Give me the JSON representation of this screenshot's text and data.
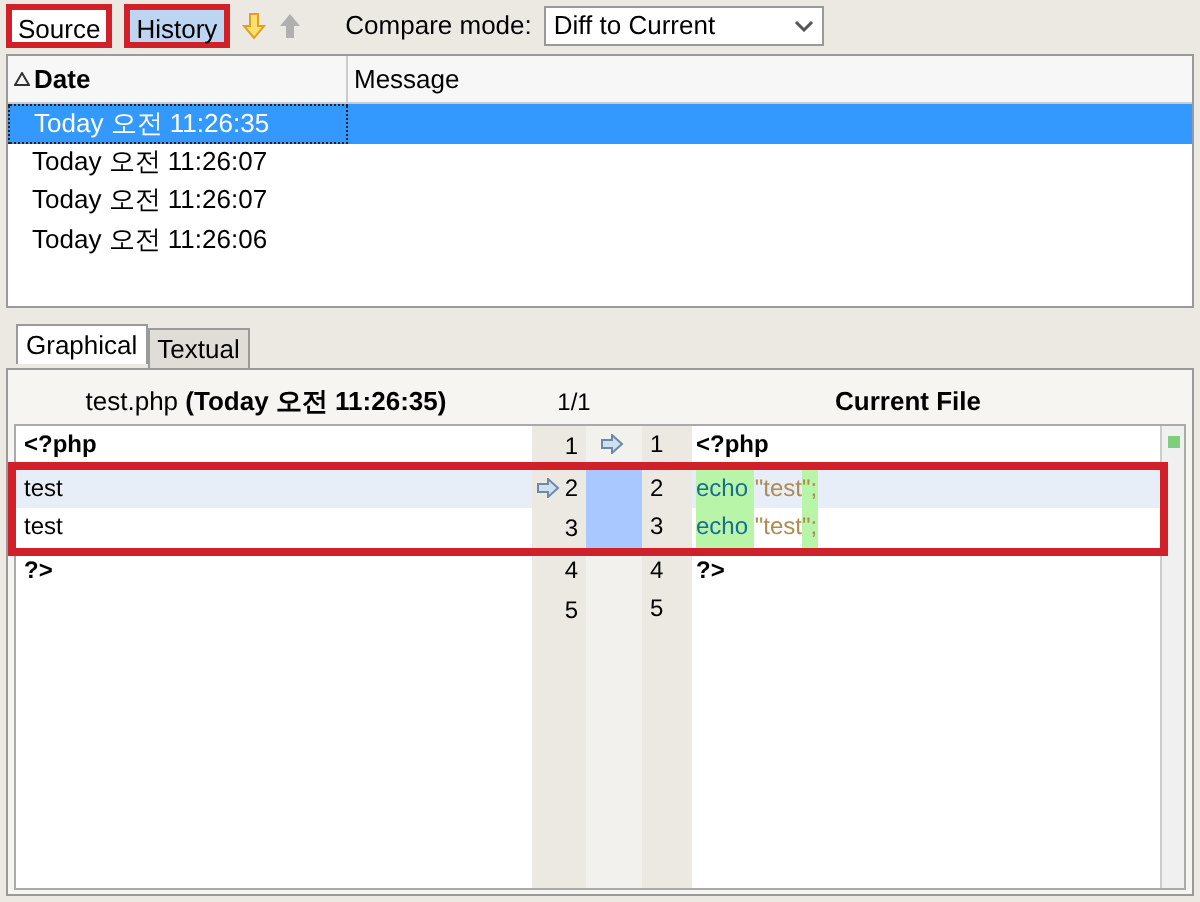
{
  "toolbar": {
    "buttons": [
      {
        "label": "Source",
        "selected": false,
        "outlined": true
      },
      {
        "label": "History",
        "selected": true,
        "outlined": true
      }
    ],
    "compare_mode": {
      "label": "Compare mode:",
      "value": "Diff to Current"
    }
  },
  "history_table": {
    "columns": [
      {
        "label": "Date",
        "sorted": true
      },
      {
        "label": "Message",
        "sorted": false
      }
    ],
    "rows": [
      {
        "date": "Today 오전 11:26:35",
        "selected": true
      },
      {
        "date": "Today 오전 11:26:07",
        "selected": false
      },
      {
        "date": "Today 오전 11:26:07",
        "selected": false
      },
      {
        "date": "Today 오전 11:26:06",
        "selected": false
      }
    ]
  },
  "tabs": [
    {
      "label": "Graphical",
      "selected": true
    },
    {
      "label": "Textual",
      "selected": false
    }
  ],
  "diff": {
    "left_title": {
      "name": "test.php",
      "revision": "(Today 오전 11:26:35)"
    },
    "counter": "1/1",
    "right_title": "Current File",
    "rows": [
      {
        "left_no": "1",
        "left_text": "<?php",
        "right_no": "1",
        "right": [
          {
            "text": "<?php",
            "kind": "plain",
            "changed": false
          }
        ],
        "changed": false,
        "current": false,
        "outlined": false,
        "bold": true
      },
      {
        "left_no": "2",
        "left_text": "test",
        "right_no": "2",
        "right": [
          {
            "text": "echo ",
            "kind": "keyword",
            "changed": true
          },
          {
            "text": "\"",
            "kind": "string",
            "changed": false
          },
          {
            "text": "test",
            "kind": "string",
            "changed": false
          },
          {
            "text": "\";",
            "kind": "string",
            "changed": true
          }
        ],
        "changed": true,
        "current": true,
        "outlined": true,
        "bold": false
      },
      {
        "left_no": "3",
        "left_text": "test",
        "right_no": "3",
        "right": [
          {
            "text": "echo ",
            "kind": "keyword",
            "changed": true
          },
          {
            "text": "\"",
            "kind": "string",
            "changed": false
          },
          {
            "text": "test",
            "kind": "string",
            "changed": false
          },
          {
            "text": "\";",
            "kind": "string",
            "changed": true
          }
        ],
        "changed": true,
        "current": false,
        "outlined": true,
        "bold": false
      },
      {
        "left_no": "4",
        "left_text": "?>",
        "right_no": "4",
        "right": [
          {
            "text": "?>",
            "kind": "plain",
            "changed": false
          }
        ],
        "changed": false,
        "current": false,
        "outlined": false,
        "bold": true
      },
      {
        "left_no": "5",
        "left_text": "",
        "right_no": "5",
        "right": [],
        "changed": false,
        "current": false,
        "outlined": false,
        "bold": false
      }
    ]
  }
}
